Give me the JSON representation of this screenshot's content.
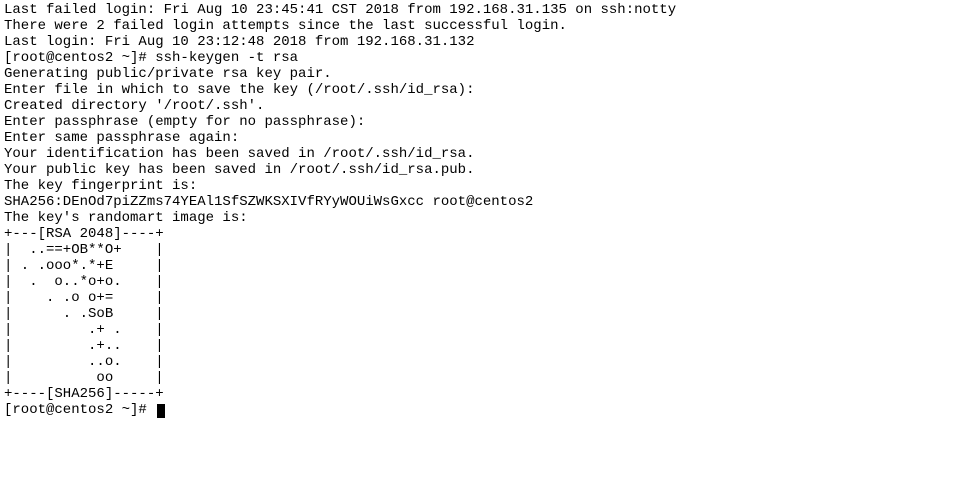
{
  "terminal": {
    "lines": [
      "Last failed login: Fri Aug 10 23:45:41 CST 2018 from 192.168.31.135 on ssh:notty",
      "There were 2 failed login attempts since the last successful login.",
      "Last login: Fri Aug 10 23:12:48 2018 from 192.168.31.132",
      "[root@centos2 ~]# ssh-keygen -t rsa",
      "Generating public/private rsa key pair.",
      "Enter file in which to save the key (/root/.ssh/id_rsa):",
      "Created directory '/root/.ssh'.",
      "Enter passphrase (empty for no passphrase):",
      "Enter same passphrase again:",
      "Your identification has been saved in /root/.ssh/id_rsa.",
      "Your public key has been saved in /root/.ssh/id_rsa.pub.",
      "The key fingerprint is:",
      "SHA256:DEnOd7piZZms74YEAl1SfSZWKSXIVfRYyWOUiWsGxcc root@centos2",
      "The key's randomart image is:",
      "+---[RSA 2048]----+",
      "|  ..==+OB**O+    |",
      "| . .ooo*.*+E     |",
      "|  .  o..*o+o.    |",
      "|    . .o o+=     |",
      "|      . .SoB     |",
      "|         .+ .    |",
      "|         .+..    |",
      "|         ..o.    |",
      "|          oo     |",
      "+----[SHA256]-----+"
    ],
    "prompt": "[root@centos2 ~]# "
  }
}
